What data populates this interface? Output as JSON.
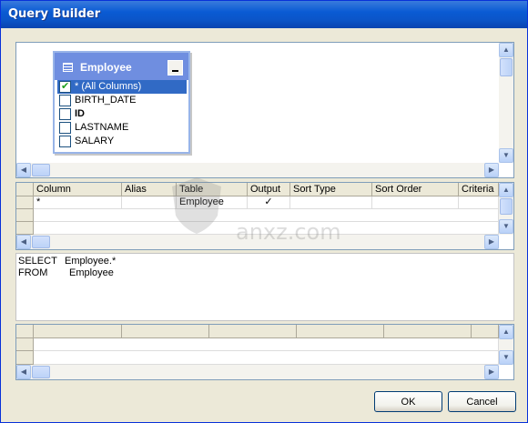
{
  "window": {
    "title": "Query Builder"
  },
  "diagram": {
    "table": {
      "name": "Employee",
      "columns": [
        {
          "label": "* (All Columns)",
          "checked": true,
          "selected": true
        },
        {
          "label": "BIRTH_DATE",
          "checked": false,
          "selected": false
        },
        {
          "label": "ID",
          "checked": false,
          "selected": false,
          "bold": true
        },
        {
          "label": "LASTNAME",
          "checked": false,
          "selected": false
        },
        {
          "label": "SALARY",
          "checked": false,
          "selected": false
        }
      ]
    }
  },
  "criteria_grid": {
    "headers": [
      "Column",
      "Alias",
      "Table",
      "Output",
      "Sort Type",
      "Sort Order",
      "Criteria"
    ],
    "rows": [
      {
        "column": "*",
        "alias": "",
        "table": "Employee",
        "output": "✓",
        "sort_type": "",
        "sort_order": "",
        "criteria": ""
      }
    ]
  },
  "sql": {
    "line1_keyword": "SELECT",
    "line1_value": "Employee.*",
    "line2_keyword": "FROM",
    "line2_value": "Employee"
  },
  "results_grid": {
    "headers": [
      "",
      "",
      "",
      "",
      "",
      ""
    ]
  },
  "buttons": {
    "ok": "OK",
    "cancel": "Cancel"
  },
  "watermark": {
    "text": "anxz.com"
  }
}
